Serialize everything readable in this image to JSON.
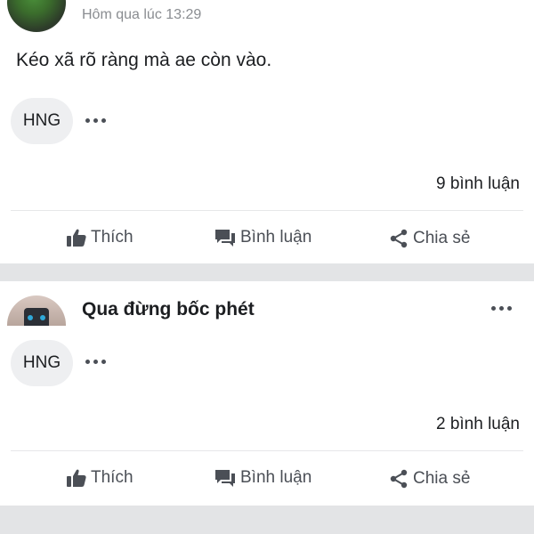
{
  "posts": [
    {
      "timestamp": "Hôm qua lúc 13:29",
      "text": "Kéo xã rõ ràng mà ae còn vào.",
      "chip": "HNG",
      "comments": "9 bình luận",
      "actions": {
        "like": "Thích",
        "comment": "Bình luận",
        "share": "Chia sẻ"
      }
    },
    {
      "author": "Qua đừng bốc phét",
      "chip": "HNG",
      "comments": "2 bình luận",
      "actions": {
        "like": "Thích",
        "comment": "Bình luận",
        "share": "Chia sẻ"
      }
    }
  ],
  "icons": [
    "like-icon",
    "comment-icon",
    "share-icon",
    "more-icon"
  ],
  "colors": {
    "text": "#1c1e21",
    "muted": "#8a8d91",
    "icon": "#4b4f56",
    "separator": "#e3e4e6",
    "chip": "#eeeff1"
  }
}
